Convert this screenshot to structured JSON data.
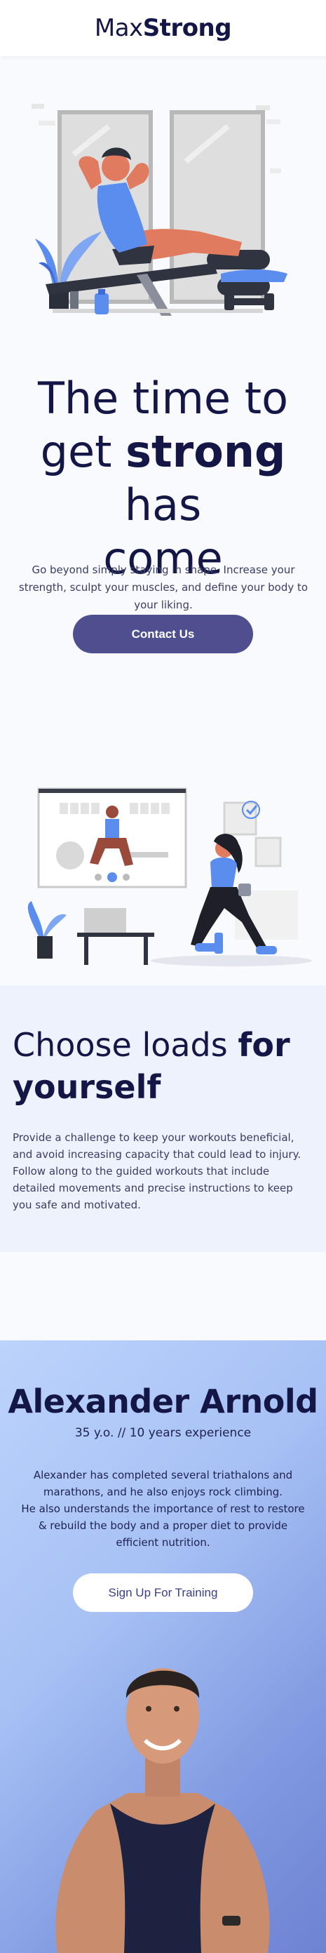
{
  "header": {
    "logo_light": "Max",
    "logo_bold": "Strong"
  },
  "hero": {
    "title_line1": "The time to",
    "title_get": "get ",
    "title_strong": "strong",
    "title_has": " has",
    "title_line3": "come",
    "text": "Go beyond simply staying in shape. Increase your strength, sculpt your muscles, and define your body to your liking.",
    "button_label": "Contact Us"
  },
  "section2": {
    "title_regular": "Choose loads ",
    "title_bold": "for yourself",
    "paragraph1": "Provide a challenge to keep your workouts beneficial, and avoid increasing capacity that could lead to injury.",
    "paragraph2": "Follow along to the guided workouts that include detailed movements and precise instructions to keep you safe and motivated."
  },
  "trainer": {
    "name": "Alexander Arnold",
    "subtitle": "35 y.o. // 10 years experience",
    "text_line1": "Alexander has completed several triathalons and marathons, and he also enjoys rock climbing.",
    "text_line2": "He also understands the importance of rest to restore & rebuild the body and a proper diet to provide efficient nutrition.",
    "button_label": "Sign Up For Training"
  },
  "colors": {
    "navy": "#141745",
    "button_purple": "#4f4f8f",
    "accent_blue": "#5b8def",
    "skin": "#e07b5f"
  }
}
